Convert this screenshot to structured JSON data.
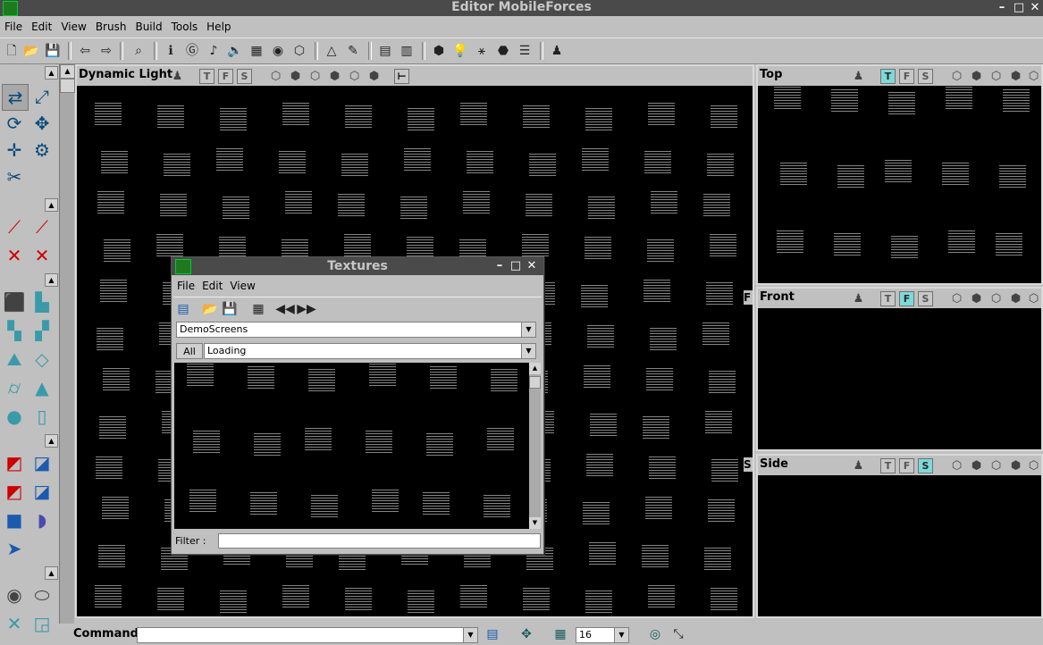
{
  "window": {
    "title": "Editor MobileForces"
  },
  "menu": [
    "File",
    "Edit",
    "View",
    "Brush",
    "Build",
    "Tools",
    "Help"
  ],
  "viewports": {
    "main": {
      "title": "Dynamic Light"
    },
    "top": {
      "title": "Top"
    },
    "front": {
      "title": "Front"
    },
    "side": {
      "title": "Side"
    },
    "toggles": {
      "t": "T",
      "f": "F",
      "s": "S"
    },
    "edge_labels": {
      "f": "F",
      "s": "S"
    }
  },
  "textures": {
    "title": "Textures",
    "menu": [
      "File",
      "Edit",
      "View"
    ],
    "package": "DemoScreens",
    "all_label": "All",
    "group": "Loading",
    "filter_label": "Filter :",
    "filter_value": ""
  },
  "bottom": {
    "command_label": "Command",
    "command_value": "",
    "grid_value": "16"
  }
}
